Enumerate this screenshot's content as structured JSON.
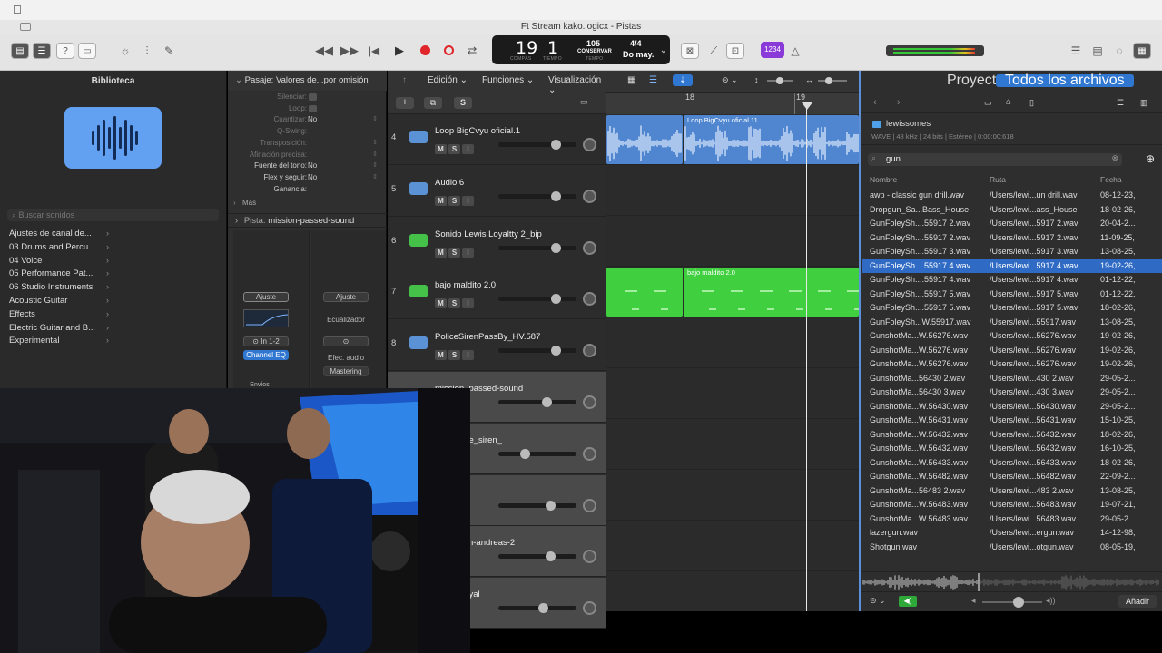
{
  "window": {
    "title": "Ft Stream kako.logicx - Pistas"
  },
  "lcd": {
    "bar": "19",
    "beat": "1",
    "bar_label": "COMPÁS",
    "beat_label": "TIEMPO",
    "tempo": "105",
    "tempo_mode": "CONSERVAR",
    "tempo_label": "TEMPO",
    "signature": "4/4",
    "key": "Do may."
  },
  "toolbar": {
    "count_in": "1234"
  },
  "library": {
    "title": "Biblioteca",
    "search_placeholder": "Buscar sonidos",
    "items": [
      "Ajustes de canal de...",
      "03 Drums and Percu...",
      "04 Voice",
      "05 Performance Pat...",
      "06 Studio Instruments",
      "Acoustic Guitar",
      "Effects",
      "Electric Guitar and B...",
      "Experimental"
    ]
  },
  "inspector": {
    "region_label": "Pasaje:",
    "region_value": "Valores de...por omisión",
    "params": [
      {
        "k": "Silenciar:",
        "v": ""
      },
      {
        "k": "Loop:",
        "v": ""
      },
      {
        "k": "Cuantizar:",
        "v": "No"
      },
      {
        "k": "Q-Swing:",
        "v": ""
      },
      {
        "k": "Transposición:",
        "v": ""
      },
      {
        "k": "Afinación precisa:",
        "v": ""
      },
      {
        "k": "Fuente del tono:",
        "v": "No"
      },
      {
        "k": "Flex y seguir:",
        "v": "No"
      },
      {
        "k": "Ganancia:",
        "v": ""
      }
    ],
    "more": "Más",
    "track_label": "Pista:",
    "track_value": "mission-passed-sound",
    "strip": {
      "ajuste1": "Ajuste",
      "ajuste2": "Ajuste",
      "eq": "Ecualizador",
      "input": "In 1-2",
      "channel_eq": "Channel EQ",
      "efec": "Efec. audio",
      "mastering": "Mastering",
      "envios": "Envíos"
    }
  },
  "tracks_header": {
    "edit": "Edición",
    "functions": "Funciones",
    "view": "Visualización",
    "add": "+",
    "s": "S"
  },
  "ruler": {
    "m18": "18",
    "m19": "19"
  },
  "tracks": [
    {
      "num": "4",
      "name": "Loop BigCvyu oficial.1",
      "color": "#5b92d6",
      "vol": 0.72
    },
    {
      "num": "5",
      "name": "Audio 6",
      "color": "#5b92d6",
      "vol": 0.72
    },
    {
      "num": "6",
      "name": "Sonido Lewis Loyaltty 2_bip",
      "color": "#45c14a",
      "vol": 0.72
    },
    {
      "num": "7",
      "name": "bajo maldito 2.0",
      "color": "#45c14a",
      "vol": 0.72
    },
    {
      "num": "8",
      "name": "PoliceSirenPassBy_HV.587",
      "color": "#5b92d6",
      "vol": 0.72
    },
    {
      "num": "",
      "name": "mission_passed-sound",
      "color": "#5b92d6",
      "vol": 0.6
    },
    {
      "num": "",
      "name": "_fx_police_siren_",
      "color": "#5b92d6",
      "vol": 0.3
    },
    {
      "num": "",
      "name": "",
      "color": "#5b92d6",
      "vol": 0.65
    },
    {
      "num": "",
      "name": "le-gta-san-andreas-2",
      "color": "#5b92d6",
      "vol": 0.65
    },
    {
      "num": "",
      "name": "Lewis Loyal",
      "color": "#5b92d6",
      "vol": 0.55
    }
  ],
  "regions": [
    {
      "name": "",
      "color": "#4f86cf"
    },
    {
      "name": "Loop BigCvyu oficial.11",
      "color": "#4f86cf"
    },
    {
      "name": "",
      "color": "#3fcf3f"
    },
    {
      "name": "bajo maldito 2.0",
      "color": "#3fcf3f"
    }
  ],
  "browser": {
    "tab_project": "Proyecto",
    "tab_all": "Todos los archivos",
    "folder": "lewissomes",
    "file_info": "WAVE | 48 kHz | 24 bits | Estéreo | 0:00:00:618",
    "search_value": "gun",
    "col_name": "Nombre",
    "col_path": "Ruta",
    "col_date": "Fecha",
    "files": [
      {
        "n": "awp - classic gun drill.wav",
        "p": "/Users/lewi...un drill.wav",
        "d": "08-12-23,"
      },
      {
        "n": "Dropgun_Sa...Bass_House",
        "p": "/Users/lewi...ass_House",
        "d": "18-02-26,"
      },
      {
        "n": "GunFoleySh....55917 2.wav",
        "p": "/Users/lewi...5917 2.wav",
        "d": "20-04-2..."
      },
      {
        "n": "GunFoleySh....55917 2.wav",
        "p": "/Users/lewi...5917 2.wav",
        "d": "11-09-25,"
      },
      {
        "n": "GunFoleySh....55917 3.wav",
        "p": "/Users/lewi...5917 3.wav",
        "d": "13-08-25,"
      },
      {
        "n": "GunFoleySh....55917 4.wav",
        "p": "/Users/lewi...5917 4.wav",
        "d": "19-02-26,"
      },
      {
        "n": "GunFoleySh....55917 4.wav",
        "p": "/Users/lewi...5917 4.wav",
        "d": "01-12-22,"
      },
      {
        "n": "GunFoleySh....55917 5.wav",
        "p": "/Users/lewi...5917 5.wav",
        "d": "01-12-22,"
      },
      {
        "n": "GunFoleySh....55917 5.wav",
        "p": "/Users/lewi...5917 5.wav",
        "d": "18-02-26,"
      },
      {
        "n": "GunFoleySh...W.55917.wav",
        "p": "/Users/lewi...55917.wav",
        "d": "13-08-25,"
      },
      {
        "n": "GunshotMa...W.56276.wav",
        "p": "/Users/lewi...56276.wav",
        "d": "19-02-26,"
      },
      {
        "n": "GunshotMa...W.56276.wav",
        "p": "/Users/lewi...56276.wav",
        "d": "19-02-26,"
      },
      {
        "n": "GunshotMa...W.56276.wav",
        "p": "/Users/lewi...56276.wav",
        "d": "19-02-26,"
      },
      {
        "n": "GunshotMa...56430 2.wav",
        "p": "/Users/lewi...430 2.wav",
        "d": "29-05-2..."
      },
      {
        "n": "GunshotMa...56430 3.wav",
        "p": "/Users/lewi...430 3.wav",
        "d": "29-05-2..."
      },
      {
        "n": "GunshotMa...W.56430.wav",
        "p": "/Users/lewi...56430.wav",
        "d": "29-05-2..."
      },
      {
        "n": "GunshotMa...W.56431.wav",
        "p": "/Users/lewi...56431.wav",
        "d": "15-10-25,"
      },
      {
        "n": "GunshotMa...W.56432.wav",
        "p": "/Users/lewi...56432.wav",
        "d": "18-02-26,"
      },
      {
        "n": "GunshotMa...W.56432.wav",
        "p": "/Users/lewi...56432.wav",
        "d": "16-10-25,"
      },
      {
        "n": "GunshotMa...W.56433.wav",
        "p": "/Users/lewi...56433.wav",
        "d": "18-02-26,"
      },
      {
        "n": "GunshotMa...W.56482.wav",
        "p": "/Users/lewi...56482.wav",
        "d": "22-09-2..."
      },
      {
        "n": "GunshotMa...56483 2.wav",
        "p": "/Users/lewi...483 2.wav",
        "d": "13-08-25,"
      },
      {
        "n": "GunshotMa...W.56483.wav",
        "p": "/Users/lewi...56483.wav",
        "d": "19-07-21,"
      },
      {
        "n": "GunshotMa...W.56483.wav",
        "p": "/Users/lewi...56483.wav",
        "d": "29-05-2..."
      },
      {
        "n": "lazergun.wav",
        "p": "/Users/lewi...ergun.wav",
        "d": "14-12-98,"
      },
      {
        "n": "Shotgun.wav",
        "p": "/Users/lewi...otgun.wav",
        "d": "08-05-19,"
      }
    ],
    "selected_index": 5,
    "add_button": "Añadir"
  },
  "colors": {
    "accent": "#2f77d1",
    "audio_region": "#4f86cf",
    "green_region": "#3fcf3f",
    "record": "#e0252b"
  }
}
